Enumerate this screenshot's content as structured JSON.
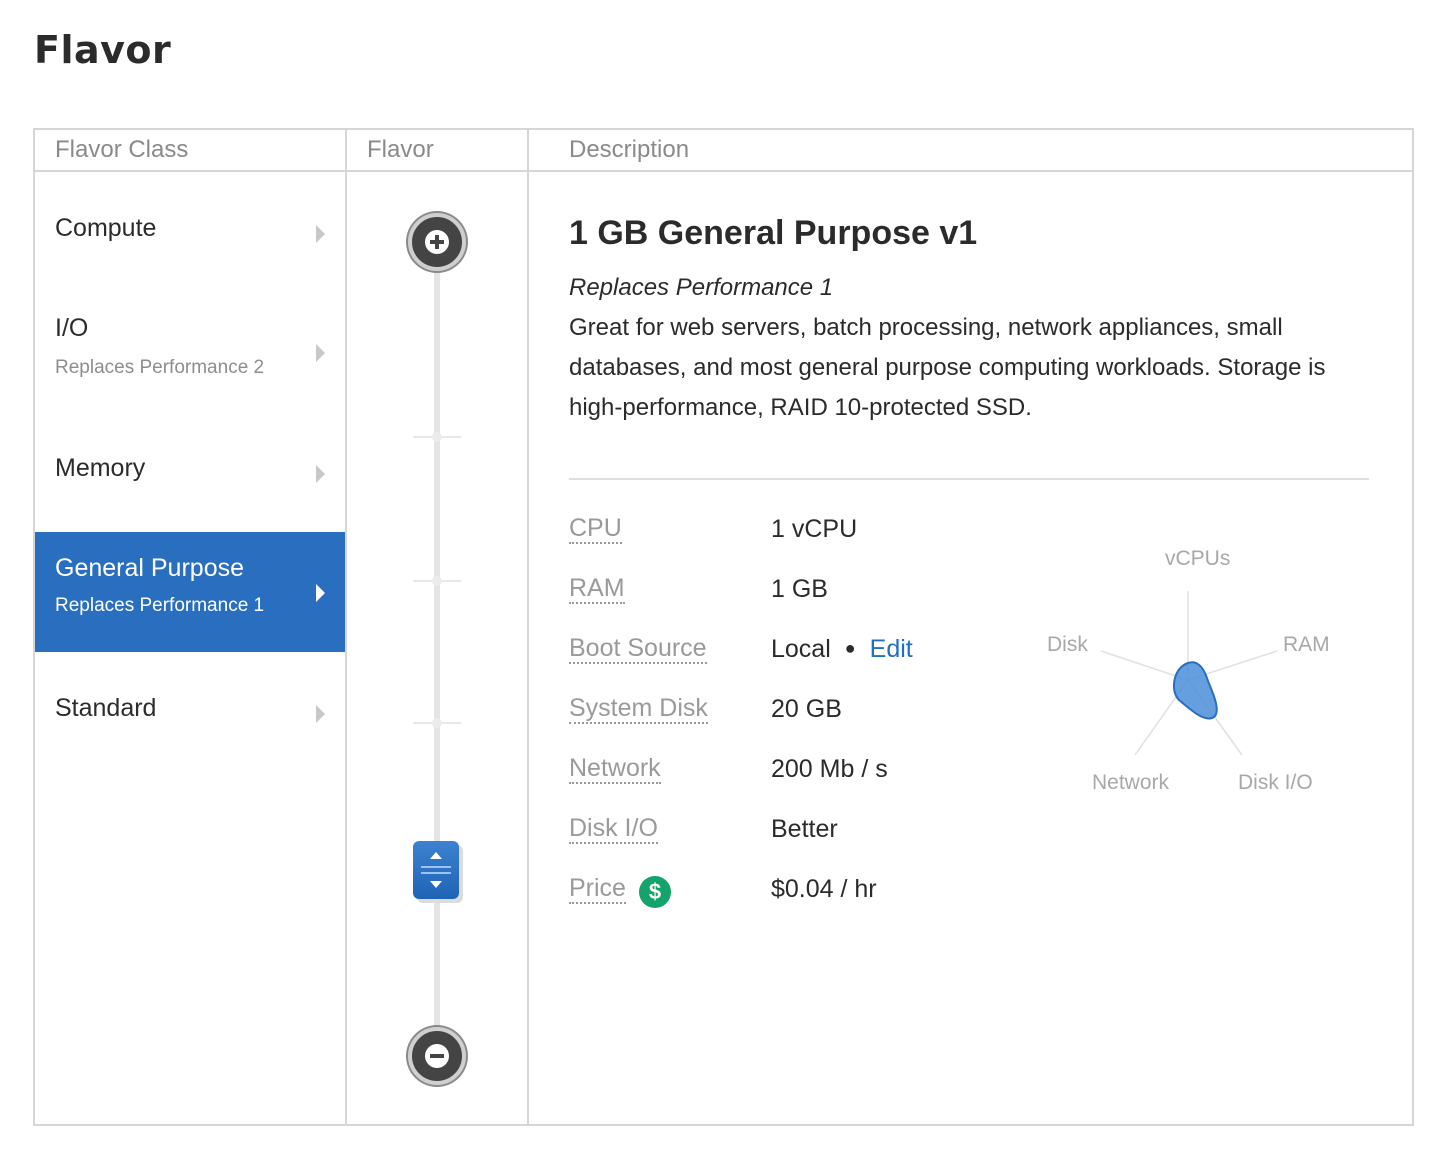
{
  "page": {
    "title": "Flavor"
  },
  "columns": {
    "flavor_class": "Flavor Class",
    "flavor": "Flavor",
    "description": "Description"
  },
  "flavor_classes": [
    {
      "label": "Compute",
      "sub": ""
    },
    {
      "label": "I/O",
      "sub": "Replaces Performance 2"
    },
    {
      "label": "Memory",
      "sub": ""
    },
    {
      "label": "General Purpose",
      "sub": "Replaces Performance 1",
      "selected": true
    },
    {
      "label": "Standard",
      "sub": ""
    }
  ],
  "slider": {
    "increase_icon": "plus-icon",
    "decrease_icon": "minus-icon",
    "handle_icon": "up-down-handle-icon"
  },
  "description": {
    "title": "1 GB General Purpose v1",
    "replaces": "Replaces Performance 1",
    "body": "Great for web servers, batch processing, network appliances, small databases, and most general purpose computing workloads. Storage is high-performance, RAID 10-protected SSD."
  },
  "specs": {
    "cpu": {
      "label": "CPU",
      "value": "1 vCPU"
    },
    "ram": {
      "label": "RAM",
      "value": "1 GB"
    },
    "boot_source": {
      "label": "Boot Source",
      "value": "Local",
      "edit": "Edit"
    },
    "system_disk": {
      "label": "System Disk",
      "value": "20 GB"
    },
    "network": {
      "label": "Network",
      "value": "200 Mb / s"
    },
    "disk_io": {
      "label": "Disk I/O",
      "value": "Better"
    },
    "price": {
      "label": "Price",
      "value": "$0.04 / hr",
      "icon": "dollar-icon",
      "icon_glyph": "$"
    }
  },
  "radar": {
    "axes": [
      "vCPUs",
      "RAM",
      "Disk I/O",
      "Network",
      "Disk"
    ]
  },
  "colors": {
    "accent": "#2a6ebf",
    "link": "#1f6fc4",
    "price_icon": "#14a36a"
  }
}
